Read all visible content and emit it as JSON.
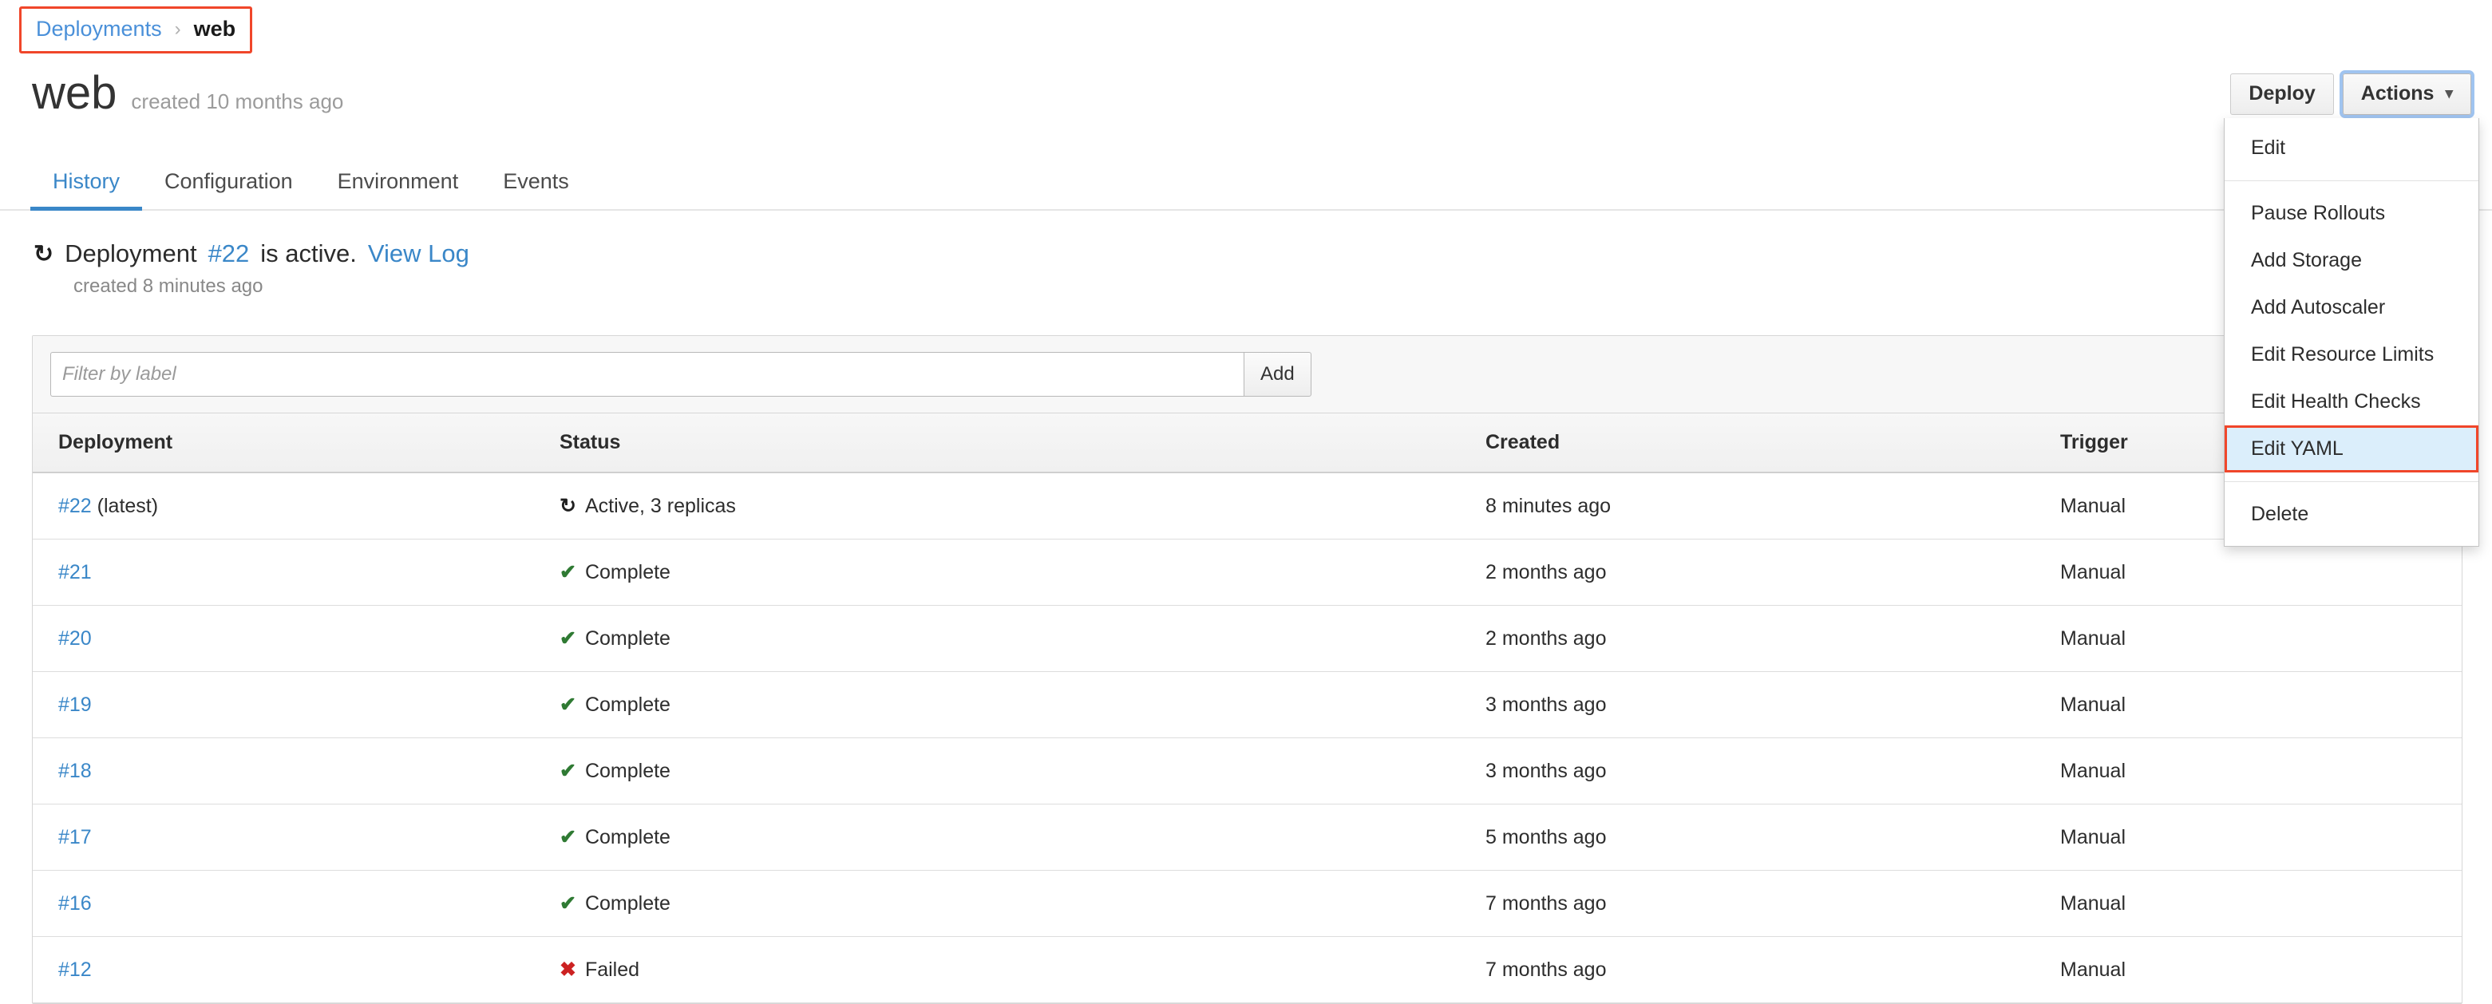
{
  "breadcrumb": {
    "parent": "Deployments",
    "separator": "›",
    "current": "web"
  },
  "header": {
    "title": "web",
    "subtitle": "created 10 months ago",
    "deploy_label": "Deploy",
    "actions_label": "Actions",
    "caret": "⌄"
  },
  "tabs": [
    {
      "label": "History",
      "active": true
    },
    {
      "label": "Configuration",
      "active": false
    },
    {
      "label": "Environment",
      "active": false
    },
    {
      "label": "Events",
      "active": false
    }
  ],
  "banner": {
    "icon": "sync-icon",
    "icon_glyph": "↻",
    "prefix": "Deployment",
    "deployment_id": "#22",
    "middle": "is active.",
    "link": "View Log",
    "created": "created 8 minutes ago"
  },
  "filter": {
    "placeholder": "Filter by label",
    "value": "",
    "add_label": "Add"
  },
  "table": {
    "columns": [
      "Deployment",
      "Status",
      "Created",
      "Trigger"
    ],
    "rows": [
      {
        "id": "#22",
        "tag": " (latest)",
        "status": "Active, 3 replicas",
        "status_icon": "sync",
        "created": "8 minutes ago",
        "trigger": "Manual"
      },
      {
        "id": "#21",
        "tag": "",
        "status": "Complete",
        "status_icon": "check",
        "created": "2 months ago",
        "trigger": "Manual"
      },
      {
        "id": "#20",
        "tag": "",
        "status": "Complete",
        "status_icon": "check",
        "created": "2 months ago",
        "trigger": "Manual"
      },
      {
        "id": "#19",
        "tag": "",
        "status": "Complete",
        "status_icon": "check",
        "created": "3 months ago",
        "trigger": "Manual"
      },
      {
        "id": "#18",
        "tag": "",
        "status": "Complete",
        "status_icon": "check",
        "created": "3 months ago",
        "trigger": "Manual"
      },
      {
        "id": "#17",
        "tag": "",
        "status": "Complete",
        "status_icon": "check",
        "created": "5 months ago",
        "trigger": "Manual"
      },
      {
        "id": "#16",
        "tag": "",
        "status": "Complete",
        "status_icon": "check",
        "created": "7 months ago",
        "trigger": "Manual"
      },
      {
        "id": "#12",
        "tag": "",
        "status": "Failed",
        "status_icon": "x",
        "created": "7 months ago",
        "trigger": "Manual"
      }
    ]
  },
  "actions_menu": {
    "open": true,
    "groups": [
      {
        "items": [
          {
            "label": "Edit",
            "highlighted": false
          }
        ]
      },
      {
        "items": [
          {
            "label": "Pause Rollouts",
            "highlighted": false
          },
          {
            "label": "Add Storage",
            "highlighted": false
          },
          {
            "label": "Add Autoscaler",
            "highlighted": false
          },
          {
            "label": "Edit Resource Limits",
            "highlighted": false
          },
          {
            "label": "Edit Health Checks",
            "highlighted": false
          },
          {
            "label": "Edit YAML",
            "highlighted": true
          }
        ]
      },
      {
        "items": [
          {
            "label": "Delete",
            "highlighted": false
          }
        ]
      }
    ]
  },
  "icons": {
    "sync": "↻",
    "check": "✔",
    "x": "✖"
  },
  "colors": {
    "link": "#3a87c8",
    "accent_tab": "#3a87c8",
    "annotation": "#f0462a",
    "highlight_bg": "#dbeefb",
    "success": "#2f7a33",
    "error": "#cc2222",
    "focus_ring": "#a0c4f0"
  }
}
